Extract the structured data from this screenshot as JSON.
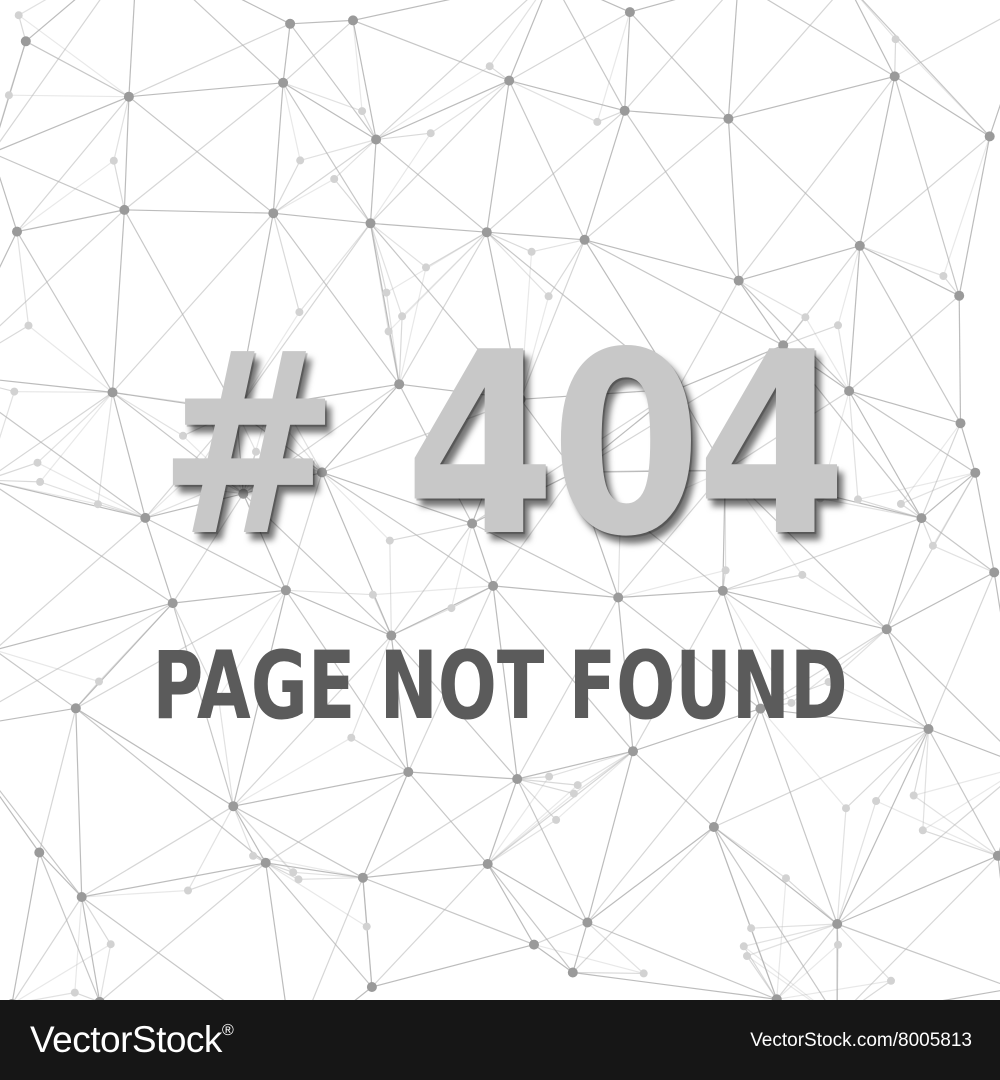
{
  "hero": {
    "code": "# 404",
    "message": "PAGE NOT FOUND"
  },
  "footer": {
    "brand": "VectorStock",
    "registered_mark": "®",
    "url": "VectorStock.com/8005813"
  },
  "colors": {
    "background": "#ffffff",
    "mesh_line": "#b5b5b5",
    "mesh_node": "#9a9a9a",
    "code_text": "#c8c8c8",
    "message_text": "#5b5b5b",
    "footer_bg": "#161616",
    "footer_text": "#ffffff"
  }
}
